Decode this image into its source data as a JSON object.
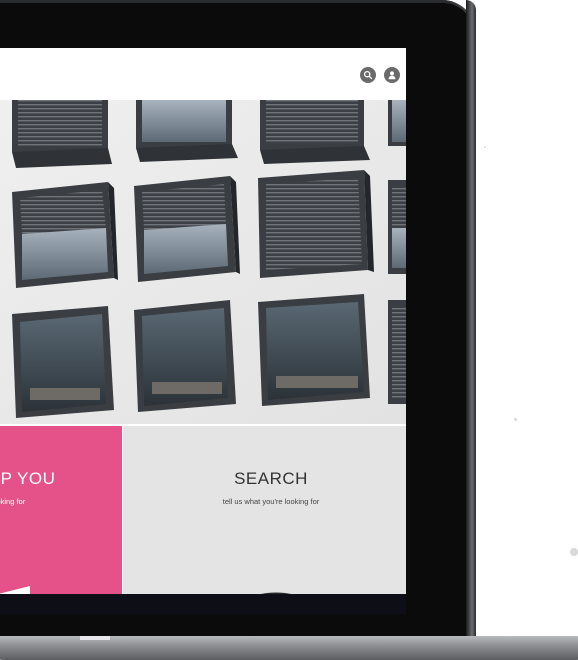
{
  "header": {
    "icons": [
      "search-icon",
      "user-icon"
    ]
  },
  "hero": {
    "image": "building-facade-windows"
  },
  "tiles": {
    "help": {
      "title": "HELP YOU",
      "subtitle": "at you're looking for",
      "color": "#e5528a"
    },
    "search": {
      "title": "SEARCH",
      "subtitle": "tell us what you're looking for",
      "color": "#e4e4e4"
    }
  },
  "colors": {
    "bezel": "#0b0b0c",
    "accent_pink": "#e5528a",
    "icon_gray": "#6a6a6a"
  }
}
